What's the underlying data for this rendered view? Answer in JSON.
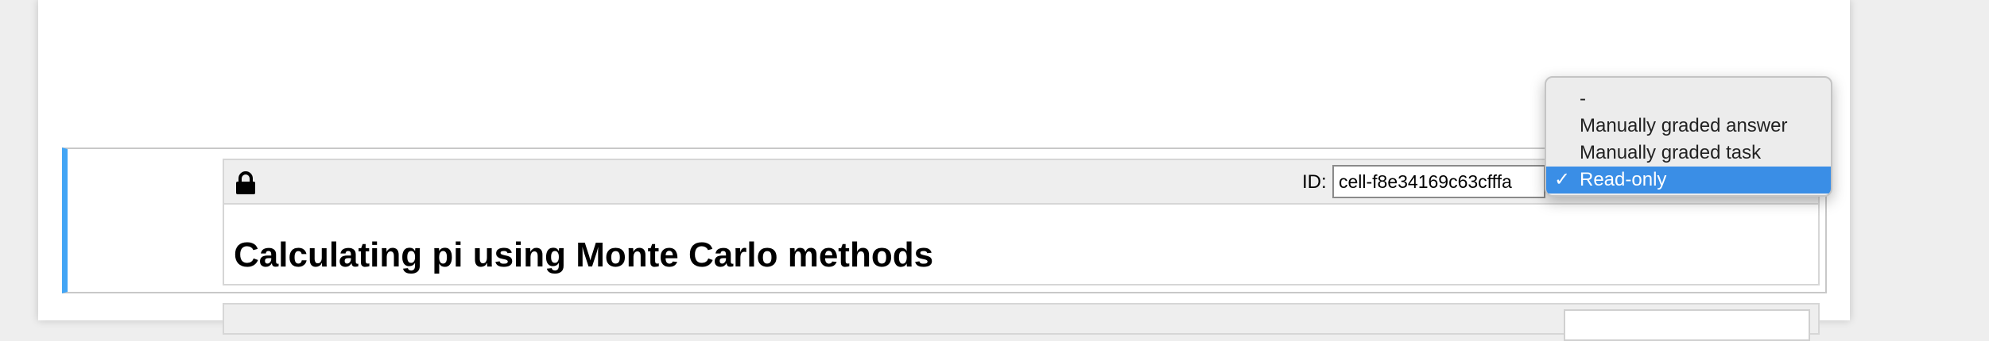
{
  "cell": {
    "lock_icon": "lock-icon",
    "id_label": "ID:",
    "id_value": "cell-f8e34169c63cfffa",
    "heading": "Calculating pi using Monte Carlo methods"
  },
  "dropdown": {
    "options": [
      {
        "label": "-",
        "selected": false
      },
      {
        "label": "Manually graded answer",
        "selected": false
      },
      {
        "label": "Manually graded task",
        "selected": false
      },
      {
        "label": "Read-only",
        "selected": true
      }
    ],
    "check_mark": "✓"
  },
  "colors": {
    "cell_accent": "#42a5f5",
    "selection": "#3a8ee6",
    "toolbar_bg": "#eeeeee"
  }
}
